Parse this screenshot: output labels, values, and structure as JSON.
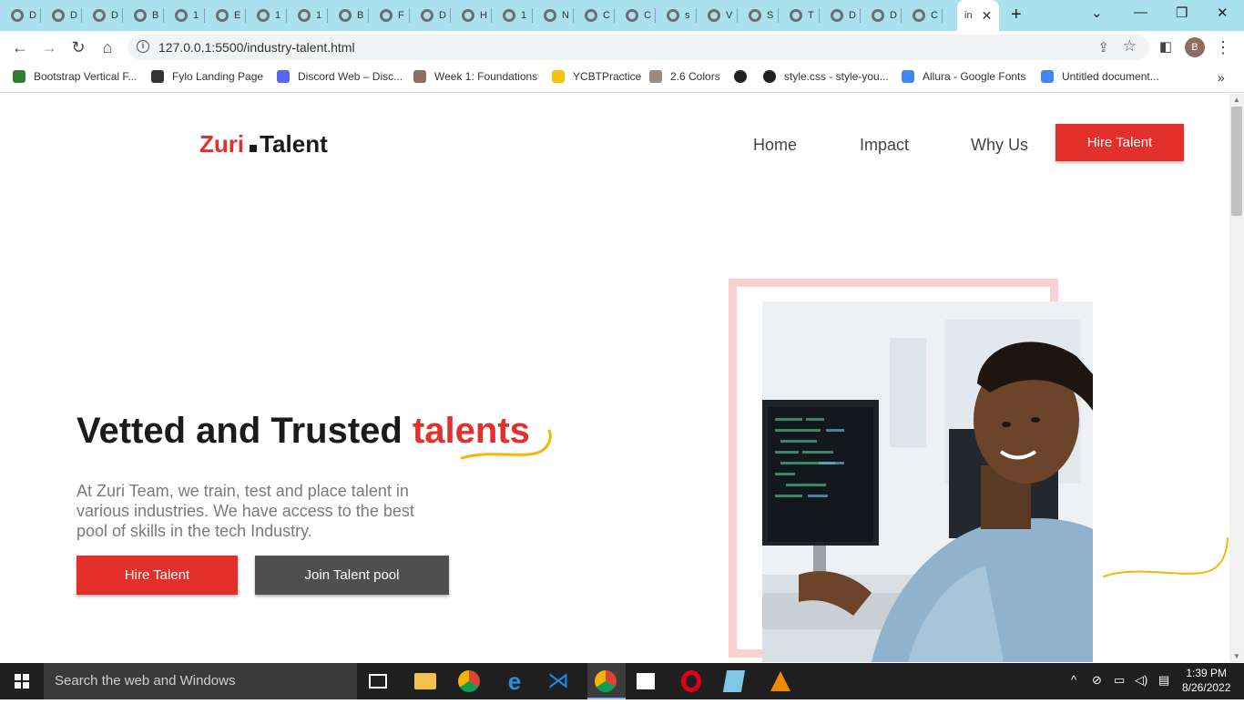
{
  "browser": {
    "tabs": [
      {
        "label": "D"
      },
      {
        "label": "D"
      },
      {
        "label": "D"
      },
      {
        "label": "B"
      },
      {
        "label": "1"
      },
      {
        "label": "E"
      },
      {
        "label": "1"
      },
      {
        "label": "1"
      },
      {
        "label": "B"
      },
      {
        "label": "F"
      },
      {
        "label": "D"
      },
      {
        "label": "H"
      },
      {
        "label": "1"
      },
      {
        "label": "N"
      },
      {
        "label": "C"
      },
      {
        "label": "C"
      },
      {
        "label": "s"
      },
      {
        "label": "V"
      },
      {
        "label": "S"
      },
      {
        "label": "T"
      },
      {
        "label": "D"
      },
      {
        "label": "D"
      },
      {
        "label": "C"
      }
    ],
    "active_tab": {
      "label": "in"
    },
    "url": "127.0.0.1:5500/industry-talent.html",
    "profile_initial": "B",
    "bookmarks": [
      {
        "label": "Bootstrap Vertical F...",
        "color": "#2e7d32"
      },
      {
        "label": "Fylo Landing Page",
        "color": "#333333"
      },
      {
        "label": "Discord Web – Disc...",
        "color": "#5865f2"
      },
      {
        "label": "Week 1: Foundations",
        "color": "#8d6e63"
      },
      {
        "label": "YCBTPractice",
        "color": "#f4c20d"
      },
      {
        "label": "2.6 Colors",
        "color": "#a1887f"
      },
      {
        "label": "",
        "color": "#222222"
      },
      {
        "label": "style.css - style-you...",
        "color": "#222222"
      },
      {
        "label": "Allura - Google Fonts",
        "color": "#4285f4"
      },
      {
        "label": "Untitled document...",
        "color": "#4285f4"
      }
    ]
  },
  "site": {
    "logo_left": "Zuri",
    "logo_right": "Talent",
    "nav": {
      "home": "Home",
      "impact": "Impact",
      "why": "Why Us",
      "hire": "Hire Talent"
    },
    "hero": {
      "title_main": "Vetted and Trusted ",
      "title_highlight": "talents",
      "paragraph": "At Zuri Team, we train, test and place talent in various industries. We have access to the best pool of skills in the tech Industry.",
      "btn_hire": "Hire Talent",
      "btn_pool": "Join Talent pool"
    },
    "colors": {
      "accent": "#e3302a",
      "dark_button": "#4f4f4f",
      "frame": "#fbd0d0",
      "squiggle": "#f2b705"
    }
  },
  "taskbar": {
    "search_placeholder": "Search the web and Windows",
    "time": "1:39 PM",
    "date": "8/26/2022"
  }
}
